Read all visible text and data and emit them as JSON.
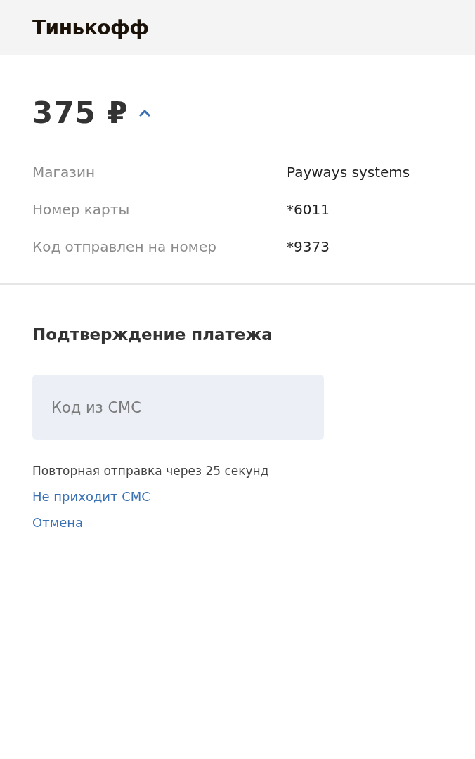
{
  "header": {
    "logo": "Тинькофф"
  },
  "payment": {
    "amount": "375 ₽",
    "expanded": true,
    "details": [
      {
        "label": "Магазин",
        "value": "Payways systems"
      },
      {
        "label": "Номер карты",
        "value": "*6011"
      },
      {
        "label": "Код отправлен на номер",
        "value": "*9373"
      }
    ]
  },
  "confirmation": {
    "title": "Подтверждение платежа",
    "code_field": {
      "placeholder": "Код из СМС"
    },
    "resend_note": "Повторная отправка через 25 секунд",
    "links": [
      "Не приходит СМС",
      "Отмена"
    ]
  }
}
